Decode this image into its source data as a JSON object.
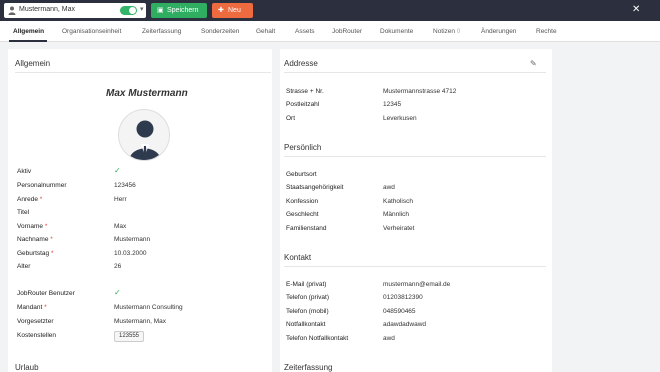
{
  "header": {
    "person_name": "Mustermann, Max",
    "save_label": "Speichern",
    "new_label": "Neu"
  },
  "tabs": [
    {
      "label": "Allgemein",
      "active": true
    },
    {
      "label": "Organisationseinheit"
    },
    {
      "label": "Zeiterfassung"
    },
    {
      "label": "Sonderzeiten"
    },
    {
      "label": "Gehalt"
    },
    {
      "label": "Assets"
    },
    {
      "label": "JobRouter"
    },
    {
      "label": "Dokumente"
    },
    {
      "label": "Notizen",
      "badge": "0"
    },
    {
      "label": "Änderungen"
    },
    {
      "label": "Rechte"
    }
  ],
  "allgemein": {
    "title": "Allgemein",
    "full_name": "Max Mustermann",
    "fields": [
      {
        "label": "Aktiv",
        "value": "✓",
        "check": true
      },
      {
        "label": "Personalnummer",
        "value": "123456"
      },
      {
        "label": "Anrede",
        "required": true,
        "value": "Herr"
      },
      {
        "label": "Titel",
        "value": ""
      },
      {
        "label": "Vorname",
        "required": true,
        "value": "Max"
      },
      {
        "label": "Nachname",
        "required": true,
        "value": "Mustermann"
      },
      {
        "label": "Geburtstag",
        "required": true,
        "value": "10.03.2000"
      },
      {
        "label": "Alter",
        "value": "26"
      }
    ],
    "fields2": [
      {
        "label": "JobRouter Benutzer",
        "value": "✓",
        "check": true
      },
      {
        "label": "Mandant",
        "required": true,
        "value": "Mustermann Consulting"
      },
      {
        "label": "Vorgesetzter",
        "value": "Mustermann, Max"
      },
      {
        "label": "Kostenstellen",
        "value": "123555"
      }
    ],
    "next_section": "Urlaub"
  },
  "adresse": {
    "title": "Addresse",
    "fields": [
      {
        "label": "Strasse + Nr.",
        "value": "Mustermannstrasse 4712"
      },
      {
        "label": "Postleitzahl",
        "value": "12345"
      },
      {
        "label": "Ort",
        "value": "Leverkusen"
      }
    ]
  },
  "persoenlich": {
    "title": "Persönlich",
    "fields": [
      {
        "label": "Geburtsort",
        "value": ""
      },
      {
        "label": "Staatsangehörigkeit",
        "value": "awd"
      },
      {
        "label": "Konfession",
        "value": "Katholisch"
      },
      {
        "label": "Geschlecht",
        "value": "Männlich"
      },
      {
        "label": "Familienstand",
        "value": "Verheiratet"
      }
    ]
  },
  "kontakt": {
    "title": "Kontakt",
    "fields": [
      {
        "label": "E-Mail (privat)",
        "value": "mustermann@email.de"
      },
      {
        "label": "Telefon (privat)",
        "value": "01203812390"
      },
      {
        "label": "Telefon (mobil)",
        "value": "048590465"
      },
      {
        "label": "Notfallkontakt",
        "value": "adawdadwawd"
      },
      {
        "label": "Telefon Notfallkontakt",
        "value": "awd"
      }
    ]
  },
  "zeiterfassung": {
    "title": "Zeiterfassung"
  }
}
